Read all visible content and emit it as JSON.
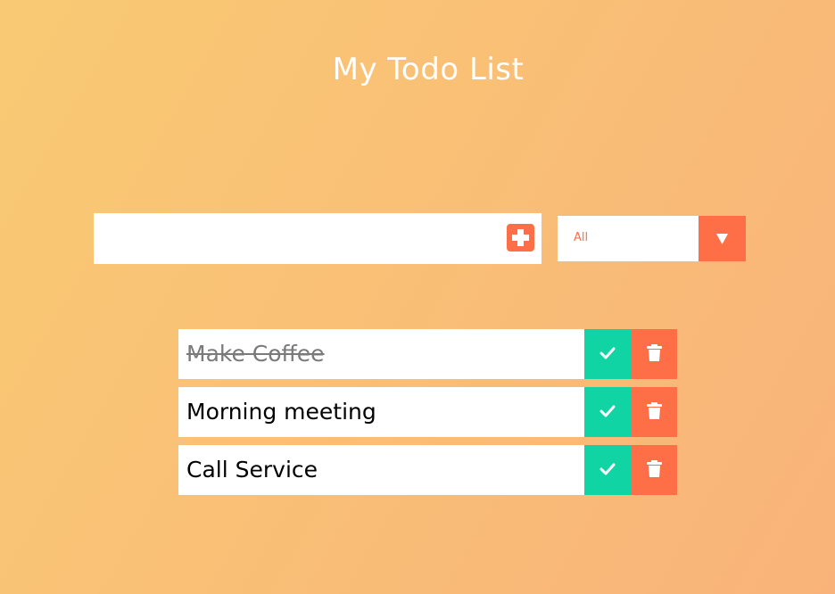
{
  "header": {
    "title": "My Todo List"
  },
  "input": {
    "value": "",
    "add_icon": "plus-icon"
  },
  "filter": {
    "selected": "All",
    "caret_icon": "caret-down-icon"
  },
  "todos": [
    {
      "text": "Make Coffee",
      "completed": true
    },
    {
      "text": "Morning meeting",
      "completed": false
    },
    {
      "text": "Call Service",
      "completed": false
    }
  ],
  "colors": {
    "accent": "#ff6f47",
    "complete": "#10d4a4",
    "background_start": "#f9ca73",
    "background_end": "#f9b37a"
  }
}
